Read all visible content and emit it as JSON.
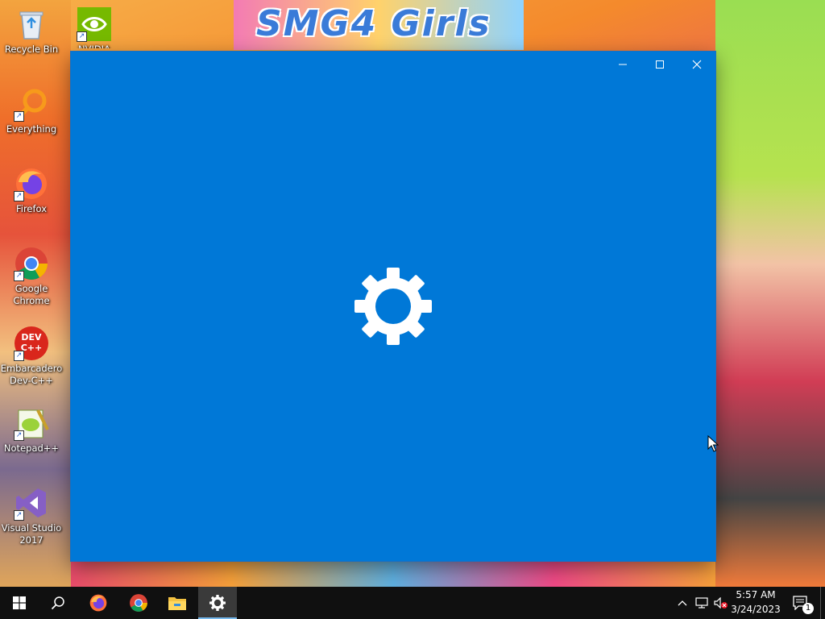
{
  "desktop": {
    "icons": [
      {
        "label": "Recycle Bin"
      },
      {
        "label": "NVIDIA"
      },
      {
        "label": "Everything"
      },
      {
        "label": "Firefox"
      },
      {
        "label": "Google Chrome"
      },
      {
        "label": "Embarcadero Dev-C++"
      },
      {
        "label": "Notepad++"
      },
      {
        "label": "Visual Studio 2017"
      }
    ],
    "wallpaper_banner": "SMG4 Girls",
    "devcpp_logo": "DEV C++"
  },
  "window": {
    "app": "Settings",
    "splash_icon": "gear-icon",
    "background": "#0078d7",
    "controls": {
      "minimize_icon": "minimize-icon",
      "maximize_icon": "maximize-icon",
      "close_icon": "close-icon"
    }
  },
  "taskbar": {
    "pinned": [
      {
        "name": "start-button",
        "icon": "windows-logo-icon"
      },
      {
        "name": "search-button",
        "icon": "search-icon"
      },
      {
        "name": "firefox",
        "icon": "firefox-icon"
      },
      {
        "name": "chrome",
        "icon": "chrome-icon"
      },
      {
        "name": "file-explorer",
        "icon": "folder-icon"
      },
      {
        "name": "settings",
        "icon": "gear-icon",
        "active": true
      }
    ],
    "tray": {
      "time": "5:57 AM",
      "date": "3/24/2023",
      "notification_count": "1"
    }
  }
}
